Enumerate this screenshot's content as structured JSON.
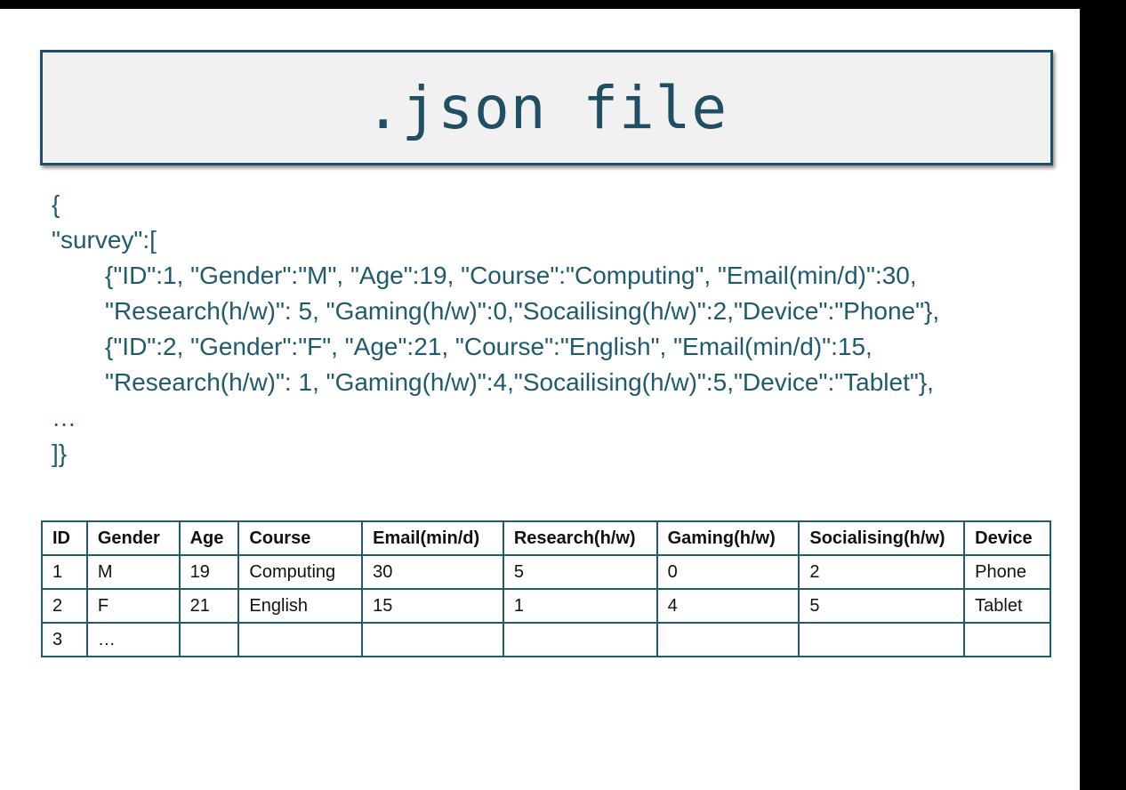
{
  "title": ".json file",
  "code_lines": [
    "{",
    "\"survey\":[",
    "{\"ID\":1, \"Gender\":\"M\", \"Age\":19, \"Course\":\"Computing\", \"Email(min/d)\":30,",
    "\"Research(h/w)\": 5, \"Gaming(h/w)\":0,\"Socailising(h/w)\":2,\"Device\":\"Phone\"},",
    "{\"ID\":2, \"Gender\":\"F\", \"Age\":21, \"Course\":\"English\", \"Email(min/d)\":15,",
    "\"Research(h/w)\": 1, \"Gaming(h/w)\":4,\"Socailising(h/w)\":5,\"Device\":\"Tablet\"},",
    "…",
    "]}"
  ],
  "table": {
    "headers": [
      "ID",
      "Gender",
      "Age",
      "Course",
      "Email(min/d)",
      "Research(h/w)",
      "Gaming(h/w)",
      "Socialising(h/w)",
      "Device"
    ],
    "rows": [
      [
        "1",
        "M",
        "19",
        "Computing",
        "30",
        "5",
        "0",
        "2",
        "Phone"
      ],
      [
        "2",
        "F",
        "21",
        "English",
        "15",
        "1",
        "4",
        "5",
        "Tablet"
      ],
      [
        "3",
        "…",
        "",
        "",
        "",
        "",
        "",
        "",
        ""
      ]
    ]
  },
  "colors": {
    "accent": "#1f5a6e",
    "title_background": "#f1f1f1",
    "title_border": "#1f5067"
  }
}
